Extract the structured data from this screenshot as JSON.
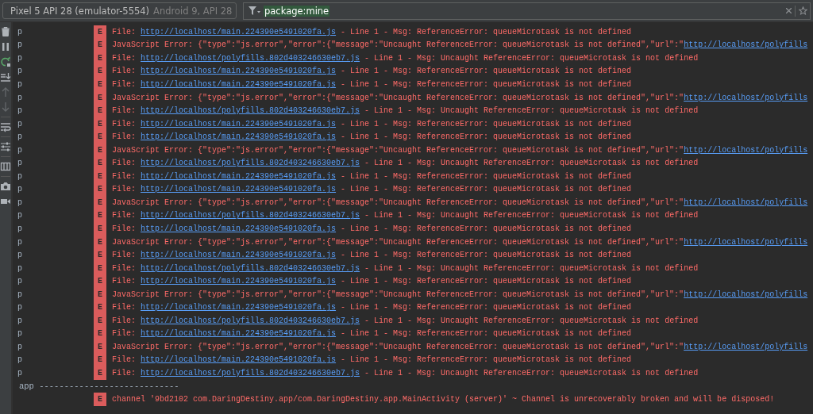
{
  "device_selector": {
    "device": "Pixel 5 API 28 (emulator-5554)",
    "detail": "Android 9, API 28"
  },
  "filter": {
    "value": "package:mine"
  },
  "toolbar": [
    {
      "kind": "trash",
      "disabled": false
    },
    {
      "kind": "pause",
      "disabled": false
    },
    {
      "kind": "restart",
      "disabled": false
    },
    {
      "kind": "scroll-end",
      "disabled": false
    },
    {
      "kind": "up",
      "disabled": true
    },
    {
      "kind": "down",
      "disabled": true
    },
    {
      "kind": "wrap",
      "disabled": false
    },
    {
      "kind": "sliders",
      "disabled": false
    },
    {
      "kind": "columns",
      "disabled": false
    },
    {
      "kind": "camera",
      "disabled": false
    },
    {
      "kind": "video",
      "disabled": false
    }
  ],
  "log_rows": [
    {
      "kind": "entry",
      "tag": "p",
      "level": "E",
      "before": "File: ",
      "link": "http://localhost/main.224390e5491020fa.js",
      "after": " - Line 1 - Msg: ReferenceError: queueMicrotask is not defined"
    },
    {
      "kind": "entry",
      "tag": "p",
      "level": "E",
      "before": "JavaScript Error: {\"type\":\"js.error\",\"error\":{\"message\":\"Uncaught ReferenceError: queueMicrotask is not defined\",\"url\":\"",
      "link": "http://localhost/polyfills"
    },
    {
      "kind": "entry",
      "tag": "p",
      "level": "E",
      "before": "File: ",
      "link": "http://localhost/polyfills.802d403246630eb7.js",
      "after": " - Line 1 - Msg: Uncaught ReferenceError: queueMicrotask is not defined"
    },
    {
      "kind": "entry",
      "tag": "p",
      "level": "E",
      "before": "File: ",
      "link": "http://localhost/main.224390e5491020fa.js",
      "after": " - Line 1 - Msg: ReferenceError: queueMicrotask is not defined"
    },
    {
      "kind": "entry",
      "tag": "p",
      "level": "E",
      "before": "File: ",
      "link": "http://localhost/main.224390e5491020fa.js",
      "after": " - Line 1 - Msg: ReferenceError: queueMicrotask is not defined"
    },
    {
      "kind": "entry",
      "tag": "p",
      "level": "E",
      "before": "JavaScript Error: {\"type\":\"js.error\",\"error\":{\"message\":\"Uncaught ReferenceError: queueMicrotask is not defined\",\"url\":\"",
      "link": "http://localhost/polyfills"
    },
    {
      "kind": "entry",
      "tag": "p",
      "level": "E",
      "before": "File: ",
      "link": "http://localhost/polyfills.802d403246630eb7.js",
      "after": " - Line 1 - Msg: Uncaught ReferenceError: queueMicrotask is not defined"
    },
    {
      "kind": "entry",
      "tag": "p",
      "level": "E",
      "before": "File: ",
      "link": "http://localhost/main.224390e5491020fa.js",
      "after": " - Line 1 - Msg: ReferenceError: queueMicrotask is not defined"
    },
    {
      "kind": "entry",
      "tag": "p",
      "level": "E",
      "before": "File: ",
      "link": "http://localhost/main.224390e5491020fa.js",
      "after": " - Line 1 - Msg: ReferenceError: queueMicrotask is not defined"
    },
    {
      "kind": "entry",
      "tag": "p",
      "level": "E",
      "before": "JavaScript Error: {\"type\":\"js.error\",\"error\":{\"message\":\"Uncaught ReferenceError: queueMicrotask is not defined\",\"url\":\"",
      "link": "http://localhost/polyfills"
    },
    {
      "kind": "entry",
      "tag": "p",
      "level": "E",
      "before": "File: ",
      "link": "http://localhost/polyfills.802d403246630eb7.js",
      "after": " - Line 1 - Msg: Uncaught ReferenceError: queueMicrotask is not defined"
    },
    {
      "kind": "entry",
      "tag": "p",
      "level": "E",
      "before": "File: ",
      "link": "http://localhost/main.224390e5491020fa.js",
      "after": " - Line 1 - Msg: ReferenceError: queueMicrotask is not defined"
    },
    {
      "kind": "entry",
      "tag": "p",
      "level": "E",
      "before": "File: ",
      "link": "http://localhost/main.224390e5491020fa.js",
      "after": " - Line 1 - Msg: ReferenceError: queueMicrotask is not defined"
    },
    {
      "kind": "entry",
      "tag": "p",
      "level": "E",
      "before": "JavaScript Error: {\"type\":\"js.error\",\"error\":{\"message\":\"Uncaught ReferenceError: queueMicrotask is not defined\",\"url\":\"",
      "link": "http://localhost/polyfills"
    },
    {
      "kind": "entry",
      "tag": "p",
      "level": "E",
      "before": "File: ",
      "link": "http://localhost/polyfills.802d403246630eb7.js",
      "after": " - Line 1 - Msg: Uncaught ReferenceError: queueMicrotask is not defined"
    },
    {
      "kind": "entry",
      "tag": "p",
      "level": "E",
      "before": "File: ",
      "link": "http://localhost/main.224390e5491020fa.js",
      "after": " - Line 1 - Msg: ReferenceError: queueMicrotask is not defined"
    },
    {
      "kind": "entry",
      "tag": "p",
      "level": "E",
      "before": "JavaScript Error: {\"type\":\"js.error\",\"error\":{\"message\":\"Uncaught ReferenceError: queueMicrotask is not defined\",\"url\":\"",
      "link": "http://localhost/polyfills"
    },
    {
      "kind": "entry",
      "tag": "p",
      "level": "E",
      "before": "File: ",
      "link": "http://localhost/main.224390e5491020fa.js",
      "after": " - Line 1 - Msg: ReferenceError: queueMicrotask is not defined"
    },
    {
      "kind": "entry",
      "tag": "p",
      "level": "E",
      "before": "File: ",
      "link": "http://localhost/polyfills.802d403246630eb7.js",
      "after": " - Line 1 - Msg: Uncaught ReferenceError: queueMicrotask is not defined"
    },
    {
      "kind": "entry",
      "tag": "p",
      "level": "E",
      "before": "File: ",
      "link": "http://localhost/main.224390e5491020fa.js",
      "after": " - Line 1 - Msg: ReferenceError: queueMicrotask is not defined"
    },
    {
      "kind": "entry",
      "tag": "p",
      "level": "E",
      "before": "JavaScript Error: {\"type\":\"js.error\",\"error\":{\"message\":\"Uncaught ReferenceError: queueMicrotask is not defined\",\"url\":\"",
      "link": "http://localhost/polyfills"
    },
    {
      "kind": "entry",
      "tag": "p",
      "level": "E",
      "before": "File: ",
      "link": "http://localhost/main.224390e5491020fa.js",
      "after": " - Line 1 - Msg: ReferenceError: queueMicrotask is not defined"
    },
    {
      "kind": "entry",
      "tag": "p",
      "level": "E",
      "before": "File: ",
      "link": "http://localhost/polyfills.802d403246630eb7.js",
      "after": " - Line 1 - Msg: Uncaught ReferenceError: queueMicrotask is not defined"
    },
    {
      "kind": "entry",
      "tag": "p",
      "level": "E",
      "before": "File: ",
      "link": "http://localhost/main.224390e5491020fa.js",
      "after": " - Line 1 - Msg: ReferenceError: queueMicrotask is not defined"
    },
    {
      "kind": "entry",
      "tag": "p",
      "level": "E",
      "before": "JavaScript Error: {\"type\":\"js.error\",\"error\":{\"message\":\"Uncaught ReferenceError: queueMicrotask is not defined\",\"url\":\"",
      "link": "http://localhost/polyfills"
    },
    {
      "kind": "entry",
      "tag": "p",
      "level": "E",
      "before": "File: ",
      "link": "http://localhost/main.224390e5491020fa.js",
      "after": " - Line 1 - Msg: ReferenceError: queueMicrotask is not defined"
    },
    {
      "kind": "entry",
      "tag": "p",
      "level": "E",
      "before": "File: ",
      "link": "http://localhost/polyfills.802d403246630eb7.js",
      "after": " - Line 1 - Msg: Uncaught ReferenceError: queueMicrotask is not defined"
    },
    {
      "kind": "separator",
      "text": "app ----------------------------"
    },
    {
      "kind": "entry",
      "level": "E",
      "before": "channel '9bd2102 com.DaringDestiny.app/com.DaringDestiny.app.MainActivity (server)' ~ Channel is unrecoverably broken and will be disposed!"
    }
  ]
}
